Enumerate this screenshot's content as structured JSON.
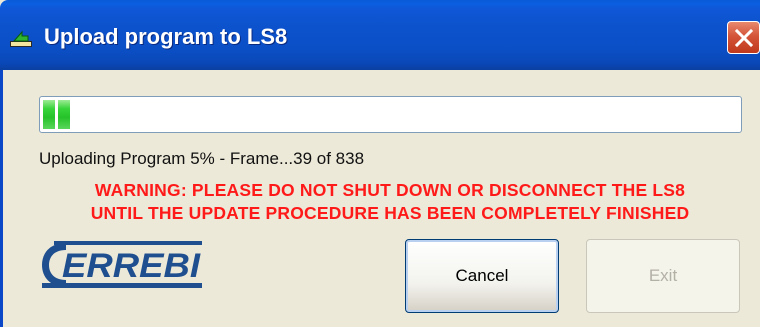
{
  "window": {
    "title": "Upload program to LS8",
    "title_icon": "upload-arrow-icon",
    "close_icon": "close-icon"
  },
  "progress": {
    "percent": 5,
    "status_text": "Uploading Program 5% - Frame...39 of 838"
  },
  "warning": {
    "line1": "WARNING: PLEASE DO NOT SHUT DOWN OR DISCONNECT THE LS8",
    "line2": "UNTIL THE UPDATE PROCEDURE HAS BEEN COMPLETELY FINISHED",
    "color": "#ff1a1a"
  },
  "logo": {
    "text": "ERREBI",
    "color": "#1f4f8f"
  },
  "buttons": {
    "cancel_label": "Cancel",
    "exit_label": "Exit"
  },
  "colors": {
    "titlebar": "#0b4fc6",
    "dialog_bg": "#ece9d8",
    "progress_fill": "#26c22a"
  }
}
